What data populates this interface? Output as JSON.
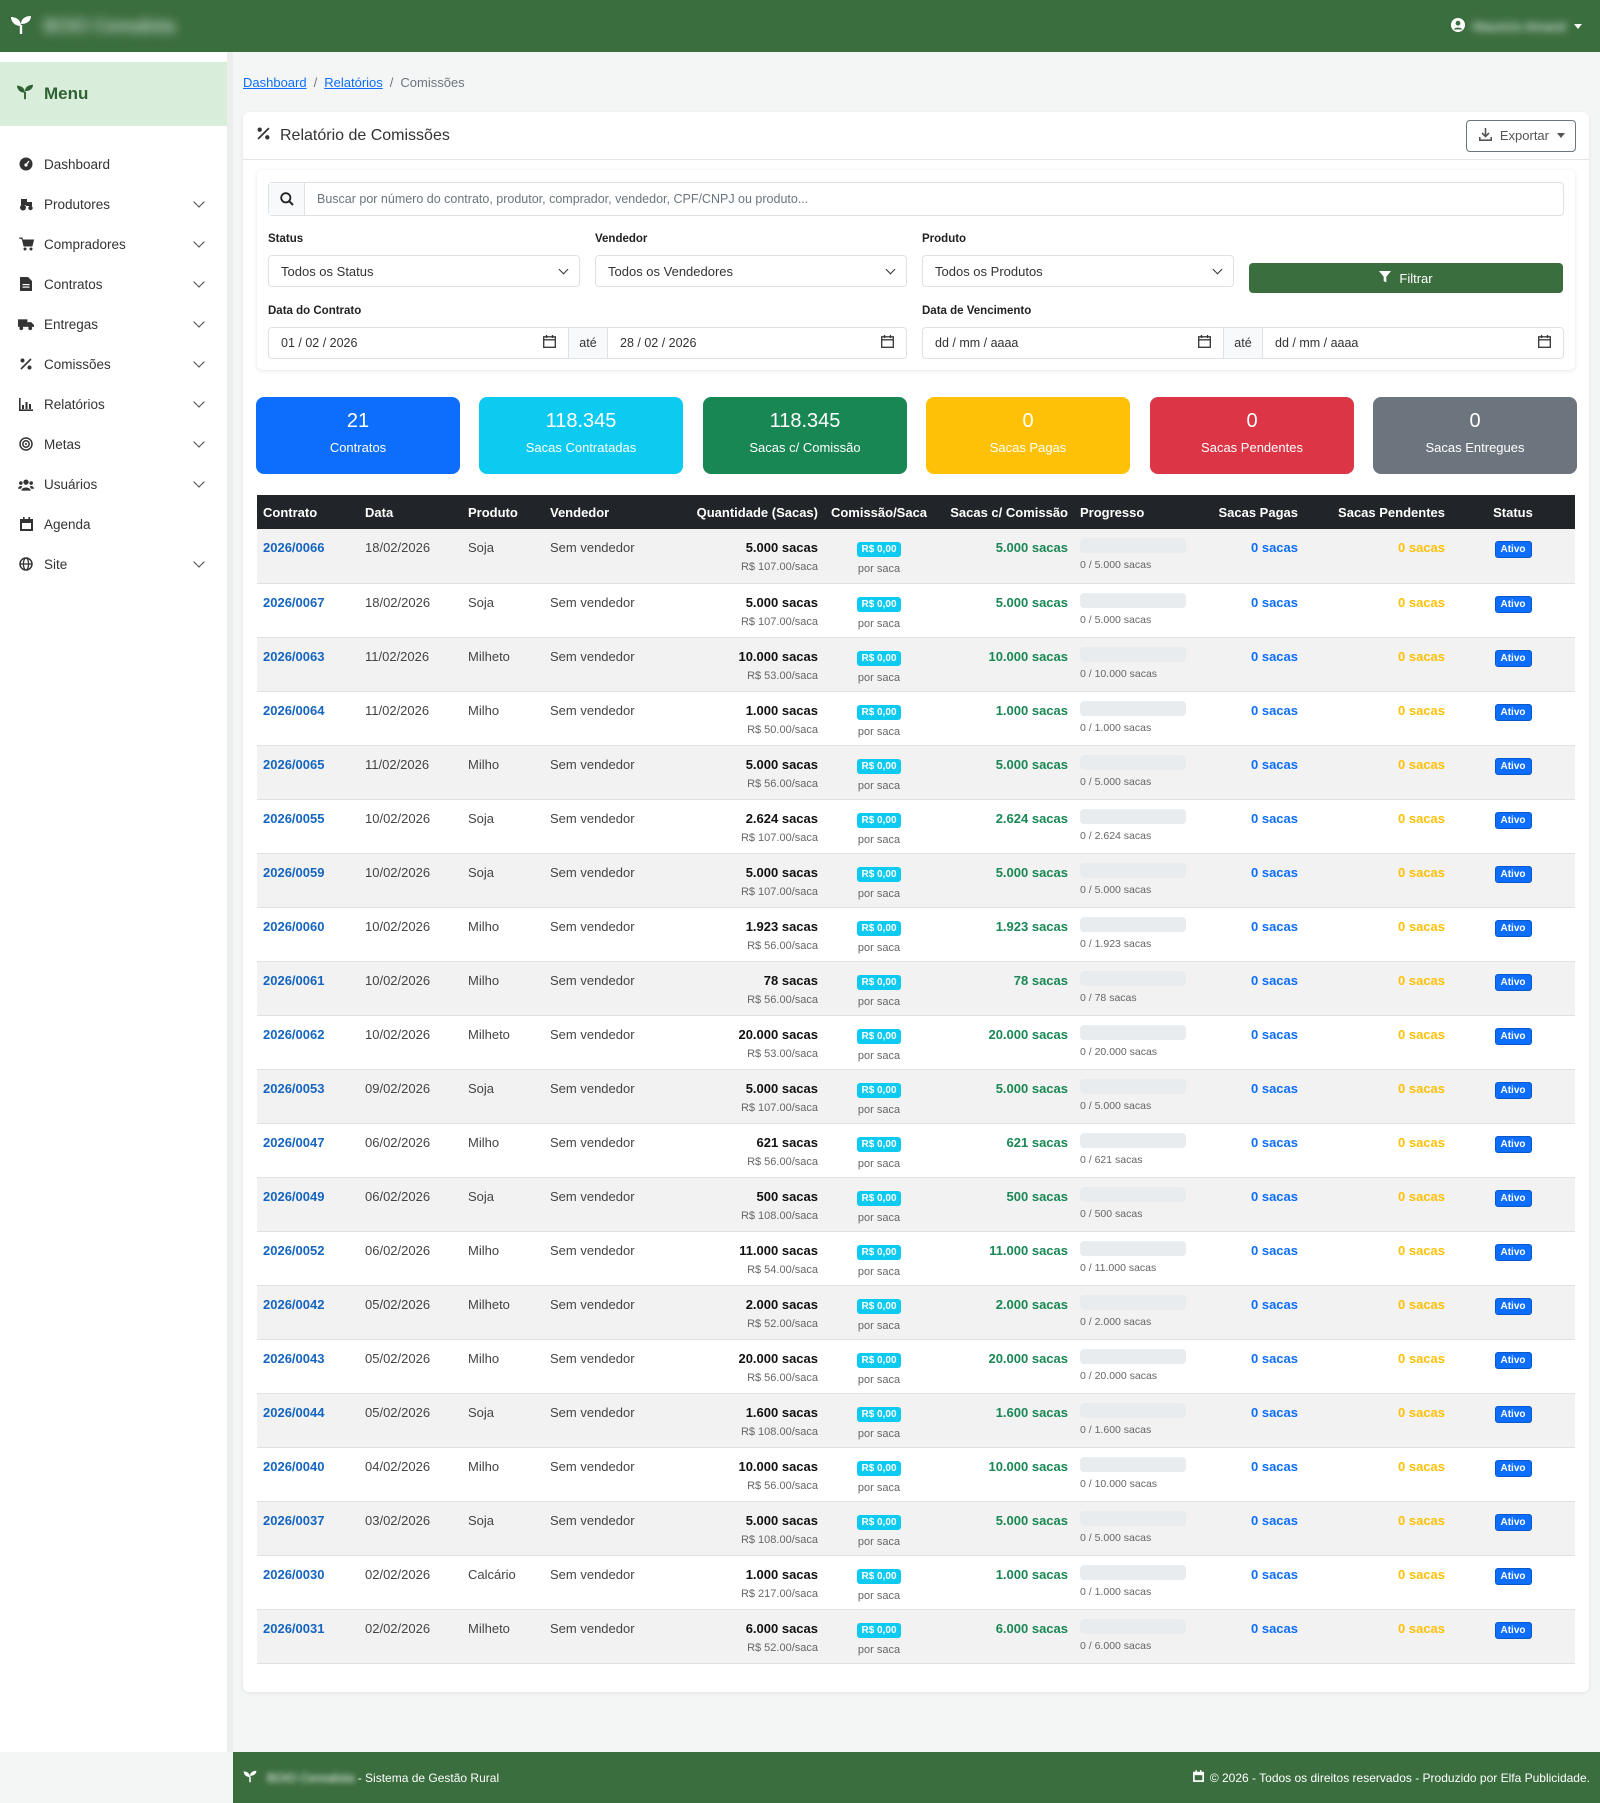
{
  "header": {
    "brand_name": "BOIO Cerealista",
    "user_name": "Mauricio Amaral"
  },
  "sidebar": {
    "title": "Menu",
    "items": [
      {
        "label": "Dashboard",
        "icon": "gauge-icon",
        "expandable": false
      },
      {
        "label": "Produtores",
        "icon": "tractor-icon",
        "expandable": true
      },
      {
        "label": "Compradores",
        "icon": "cart-icon",
        "expandable": true
      },
      {
        "label": "Contratos",
        "icon": "document-icon",
        "expandable": true
      },
      {
        "label": "Entregas",
        "icon": "truck-icon",
        "expandable": true
      },
      {
        "label": "Comissões",
        "icon": "percent-icon",
        "expandable": true
      },
      {
        "label": "Relatórios",
        "icon": "chart-icon",
        "expandable": true
      },
      {
        "label": "Metas",
        "icon": "target-icon",
        "expandable": true
      },
      {
        "label": "Usuários",
        "icon": "users-icon",
        "expandable": true
      },
      {
        "label": "Agenda",
        "icon": "calendar-icon",
        "expandable": false
      },
      {
        "label": "Site",
        "icon": "globe-icon",
        "expandable": true
      }
    ]
  },
  "breadcrumb": {
    "item1": "Dashboard",
    "item2": "Relatórios",
    "current": "Comissões",
    "separator": "/"
  },
  "card": {
    "title": "Relatório de Comissões",
    "export_label": "Exportar"
  },
  "filters": {
    "search_placeholder": "Buscar por número do contrato, produtor, comprador, vendedor, CPF/CNPJ ou produto...",
    "status_label": "Status",
    "status_value": "Todos os Status",
    "vendedor_label": "Vendedor",
    "vendedor_value": "Todos os Vendedores",
    "produto_label": "Produto",
    "produto_value": "Todos os Produtos",
    "filter_button": "Filtrar",
    "data_contrato_label": "Data do Contrato",
    "data_contrato_from": "01 / 02 / 2026",
    "data_contrato_to": "28 / 02 / 2026",
    "data_venc_label": "Data de Vencimento",
    "data_venc_from": "dd / mm / aaaa",
    "data_venc_to": "dd / mm / aaaa",
    "ate": "até"
  },
  "stats": [
    {
      "value": "21",
      "label": "Contratos",
      "color": "#0d6efd"
    },
    {
      "value": "118.345",
      "label": "Sacas Contratadas",
      "color": "#0dcaf0"
    },
    {
      "value": "118.345",
      "label": "Sacas c/ Comissão",
      "color": "#198754"
    },
    {
      "value": "0",
      "label": "Sacas Pagas",
      "color": "#ffc107"
    },
    {
      "value": "0",
      "label": "Sacas Pendentes",
      "color": "#dc3545"
    },
    {
      "value": "0",
      "label": "Sacas Entregues",
      "color": "#6c757d"
    }
  ],
  "table": {
    "columns": [
      "Contrato",
      "Data",
      "Produto",
      "Vendedor",
      "Quantidade (Sacas)",
      "Comissão/Saca",
      "Sacas c/ Comissão",
      "Progresso",
      "Sacas Pagas",
      "Sacas Pendentes",
      "Status"
    ],
    "rows": [
      {
        "contrato": "2026/0066",
        "data": "18/02/2026",
        "produto": "Soja",
        "vendedor": "Sem vendedor",
        "quantidade": "5.000 sacas",
        "preco": "R$ 107.00/saca",
        "comissao": "R$ 0,00",
        "por_saca": "por saca",
        "sacas_comissao": "5.000 sacas",
        "progresso": "0 / 5.000 sacas",
        "progress_pct": 0,
        "pagas": "0 sacas",
        "pendentes": "0 sacas",
        "status": "Ativo"
      },
      {
        "contrato": "2026/0067",
        "data": "18/02/2026",
        "produto": "Soja",
        "vendedor": "Sem vendedor",
        "quantidade": "5.000 sacas",
        "preco": "R$ 107.00/saca",
        "comissao": "R$ 0,00",
        "por_saca": "por saca",
        "sacas_comissao": "5.000 sacas",
        "progresso": "0 / 5.000 sacas",
        "progress_pct": 0,
        "pagas": "0 sacas",
        "pendentes": "0 sacas",
        "status": "Ativo"
      },
      {
        "contrato": "2026/0063",
        "data": "11/02/2026",
        "produto": "Milheto",
        "vendedor": "Sem vendedor",
        "quantidade": "10.000 sacas",
        "preco": "R$ 53.00/saca",
        "comissao": "R$ 0,00",
        "por_saca": "por saca",
        "sacas_comissao": "10.000 sacas",
        "progresso": "0 / 10.000 sacas",
        "progress_pct": 0,
        "pagas": "0 sacas",
        "pendentes": "0 sacas",
        "status": "Ativo"
      },
      {
        "contrato": "2026/0064",
        "data": "11/02/2026",
        "produto": "Milho",
        "vendedor": "Sem vendedor",
        "quantidade": "1.000 sacas",
        "preco": "R$ 50.00/saca",
        "comissao": "R$ 0,00",
        "por_saca": "por saca",
        "sacas_comissao": "1.000 sacas",
        "progresso": "0 / 1.000 sacas",
        "progress_pct": 0,
        "pagas": "0 sacas",
        "pendentes": "0 sacas",
        "status": "Ativo"
      },
      {
        "contrato": "2026/0065",
        "data": "11/02/2026",
        "produto": "Milho",
        "vendedor": "Sem vendedor",
        "quantidade": "5.000 sacas",
        "preco": "R$ 56.00/saca",
        "comissao": "R$ 0,00",
        "por_saca": "por saca",
        "sacas_comissao": "5.000 sacas",
        "progresso": "0 / 5.000 sacas",
        "progress_pct": 0,
        "pagas": "0 sacas",
        "pendentes": "0 sacas",
        "status": "Ativo"
      },
      {
        "contrato": "2026/0055",
        "data": "10/02/2026",
        "produto": "Soja",
        "vendedor": "Sem vendedor",
        "quantidade": "2.624 sacas",
        "preco": "R$ 107.00/saca",
        "comissao": "R$ 0,00",
        "por_saca": "por saca",
        "sacas_comissao": "2.624 sacas",
        "progresso": "0 / 2.624 sacas",
        "progress_pct": 0,
        "pagas": "0 sacas",
        "pendentes": "0 sacas",
        "status": "Ativo"
      },
      {
        "contrato": "2026/0059",
        "data": "10/02/2026",
        "produto": "Soja",
        "vendedor": "Sem vendedor",
        "quantidade": "5.000 sacas",
        "preco": "R$ 107.00/saca",
        "comissao": "R$ 0,00",
        "por_saca": "por saca",
        "sacas_comissao": "5.000 sacas",
        "progresso": "0 / 5.000 sacas",
        "progress_pct": 0,
        "pagas": "0 sacas",
        "pendentes": "0 sacas",
        "status": "Ativo"
      },
      {
        "contrato": "2026/0060",
        "data": "10/02/2026",
        "produto": "Milho",
        "vendedor": "Sem vendedor",
        "quantidade": "1.923 sacas",
        "preco": "R$ 56.00/saca",
        "comissao": "R$ 0,00",
        "por_saca": "por saca",
        "sacas_comissao": "1.923 sacas",
        "progresso": "0 / 1.923 sacas",
        "progress_pct": 0,
        "pagas": "0 sacas",
        "pendentes": "0 sacas",
        "status": "Ativo"
      },
      {
        "contrato": "2026/0061",
        "data": "10/02/2026",
        "produto": "Milho",
        "vendedor": "Sem vendedor",
        "quantidade": "78 sacas",
        "preco": "R$ 56.00/saca",
        "comissao": "R$ 0,00",
        "por_saca": "por saca",
        "sacas_comissao": "78 sacas",
        "progresso": "0 / 78 sacas",
        "progress_pct": 0,
        "pagas": "0 sacas",
        "pendentes": "0 sacas",
        "status": "Ativo"
      },
      {
        "contrato": "2026/0062",
        "data": "10/02/2026",
        "produto": "Milheto",
        "vendedor": "Sem vendedor",
        "quantidade": "20.000 sacas",
        "preco": "R$ 53.00/saca",
        "comissao": "R$ 0,00",
        "por_saca": "por saca",
        "sacas_comissao": "20.000 sacas",
        "progresso": "0 / 20.000 sacas",
        "progress_pct": 0,
        "pagas": "0 sacas",
        "pendentes": "0 sacas",
        "status": "Ativo"
      },
      {
        "contrato": "2026/0053",
        "data": "09/02/2026",
        "produto": "Soja",
        "vendedor": "Sem vendedor",
        "quantidade": "5.000 sacas",
        "preco": "R$ 107.00/saca",
        "comissao": "R$ 0,00",
        "por_saca": "por saca",
        "sacas_comissao": "5.000 sacas",
        "progresso": "0 / 5.000 sacas",
        "progress_pct": 0,
        "pagas": "0 sacas",
        "pendentes": "0 sacas",
        "status": "Ativo"
      },
      {
        "contrato": "2026/0047",
        "data": "06/02/2026",
        "produto": "Milho",
        "vendedor": "Sem vendedor",
        "quantidade": "621 sacas",
        "preco": "R$ 56.00/saca",
        "comissao": "R$ 0,00",
        "por_saca": "por saca",
        "sacas_comissao": "621 sacas",
        "progresso": "0 / 621 sacas",
        "progress_pct": 0,
        "pagas": "0 sacas",
        "pendentes": "0 sacas",
        "status": "Ativo"
      },
      {
        "contrato": "2026/0049",
        "data": "06/02/2026",
        "produto": "Soja",
        "vendedor": "Sem vendedor",
        "quantidade": "500 sacas",
        "preco": "R$ 108.00/saca",
        "comissao": "R$ 0,00",
        "por_saca": "por saca",
        "sacas_comissao": "500 sacas",
        "progresso": "0 / 500 sacas",
        "progress_pct": 0,
        "pagas": "0 sacas",
        "pendentes": "0 sacas",
        "status": "Ativo"
      },
      {
        "contrato": "2026/0052",
        "data": "06/02/2026",
        "produto": "Milho",
        "vendedor": "Sem vendedor",
        "quantidade": "11.000 sacas",
        "preco": "R$ 54.00/saca",
        "comissao": "R$ 0,00",
        "por_saca": "por saca",
        "sacas_comissao": "11.000 sacas",
        "progresso": "0 / 11.000 sacas",
        "progress_pct": 0,
        "pagas": "0 sacas",
        "pendentes": "0 sacas",
        "status": "Ativo"
      },
      {
        "contrato": "2026/0042",
        "data": "05/02/2026",
        "produto": "Milheto",
        "vendedor": "Sem vendedor",
        "quantidade": "2.000 sacas",
        "preco": "R$ 52.00/saca",
        "comissao": "R$ 0,00",
        "por_saca": "por saca",
        "sacas_comissao": "2.000 sacas",
        "progresso": "0 / 2.000 sacas",
        "progress_pct": 0,
        "pagas": "0 sacas",
        "pendentes": "0 sacas",
        "status": "Ativo"
      },
      {
        "contrato": "2026/0043",
        "data": "05/02/2026",
        "produto": "Milho",
        "vendedor": "Sem vendedor",
        "quantidade": "20.000 sacas",
        "preco": "R$ 56.00/saca",
        "comissao": "R$ 0,00",
        "por_saca": "por saca",
        "sacas_comissao": "20.000 sacas",
        "progresso": "0 / 20.000 sacas",
        "progress_pct": 0,
        "pagas": "0 sacas",
        "pendentes": "0 sacas",
        "status": "Ativo"
      },
      {
        "contrato": "2026/0044",
        "data": "05/02/2026",
        "produto": "Soja",
        "vendedor": "Sem vendedor",
        "quantidade": "1.600 sacas",
        "preco": "R$ 108.00/saca",
        "comissao": "R$ 0,00",
        "por_saca": "por saca",
        "sacas_comissao": "1.600 sacas",
        "progresso": "0 / 1.600 sacas",
        "progress_pct": 0,
        "pagas": "0 sacas",
        "pendentes": "0 sacas",
        "status": "Ativo"
      },
      {
        "contrato": "2026/0040",
        "data": "04/02/2026",
        "produto": "Milho",
        "vendedor": "Sem vendedor",
        "quantidade": "10.000 sacas",
        "preco": "R$ 56.00/saca",
        "comissao": "R$ 0,00",
        "por_saca": "por saca",
        "sacas_comissao": "10.000 sacas",
        "progresso": "0 / 10.000 sacas",
        "progress_pct": 0,
        "pagas": "0 sacas",
        "pendentes": "0 sacas",
        "status": "Ativo"
      },
      {
        "contrato": "2026/0037",
        "data": "03/02/2026",
        "produto": "Soja",
        "vendedor": "Sem vendedor",
        "quantidade": "5.000 sacas",
        "preco": "R$ 108.00/saca",
        "comissao": "R$ 0,00",
        "por_saca": "por saca",
        "sacas_comissao": "5.000 sacas",
        "progresso": "0 / 5.000 sacas",
        "progress_pct": 0,
        "pagas": "0 sacas",
        "pendentes": "0 sacas",
        "status": "Ativo"
      },
      {
        "contrato": "2026/0030",
        "data": "02/02/2026",
        "produto": "Calcário",
        "vendedor": "Sem vendedor",
        "quantidade": "1.000 sacas",
        "preco": "R$ 217.00/saca",
        "comissao": "R$ 0,00",
        "por_saca": "por saca",
        "sacas_comissao": "1.000 sacas",
        "progresso": "0 / 1.000 sacas",
        "progress_pct": 0,
        "pagas": "0 sacas",
        "pendentes": "0 sacas",
        "status": "Ativo"
      },
      {
        "contrato": "2026/0031",
        "data": "02/02/2026",
        "produto": "Milheto",
        "vendedor": "Sem vendedor",
        "quantidade": "6.000 sacas",
        "preco": "R$ 52.00/saca",
        "comissao": "R$ 0,00",
        "por_saca": "por saca",
        "sacas_comissao": "6.000 sacas",
        "progresso": "0 / 6.000 sacas",
        "progress_pct": 0,
        "pagas": "0 sacas",
        "pendentes": "0 sacas",
        "status": "Ativo"
      }
    ]
  },
  "footer": {
    "brand_name": "BOIO Cerealista",
    "system_text": "- Sistema de Gestão Rural",
    "copyright": "© 2026 - Todos os direitos reservados - Produzido por Elfa Publicidade."
  }
}
